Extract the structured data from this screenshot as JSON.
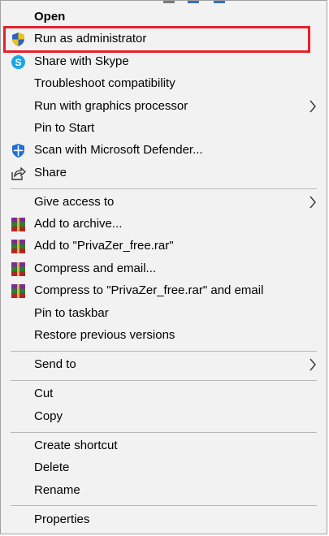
{
  "menu": {
    "items": [
      {
        "label": "Open"
      },
      {
        "label": "Run as administrator",
        "icon": "uac-shield-icon"
      },
      {
        "label": "Share with Skype",
        "icon": "skype-icon"
      },
      {
        "label": "Troubleshoot compatibility"
      },
      {
        "label": "Run with graphics processor",
        "submenu": true
      },
      {
        "label": "Pin to Start"
      },
      {
        "label": "Scan with Microsoft Defender...",
        "icon": "defender-shield-icon"
      },
      {
        "label": "Share",
        "icon": "share-icon"
      },
      {
        "label": "Give access to",
        "submenu": true
      },
      {
        "label": "Add to archive...",
        "icon": "winrar-icon"
      },
      {
        "label": "Add to \"PrivaZer_free.rar\"",
        "icon": "winrar-icon"
      },
      {
        "label": "Compress and email...",
        "icon": "winrar-icon"
      },
      {
        "label": "Compress to \"PrivaZer_free.rar\" and email",
        "icon": "winrar-icon"
      },
      {
        "label": "Pin to taskbar"
      },
      {
        "label": "Restore previous versions"
      },
      {
        "label": "Send to",
        "submenu": true
      },
      {
        "label": "Cut"
      },
      {
        "label": "Copy"
      },
      {
        "label": "Create shortcut"
      },
      {
        "label": "Delete"
      },
      {
        "label": "Rename"
      },
      {
        "label": "Properties"
      }
    ]
  },
  "colors": {
    "menu_background": "#f2f2f2",
    "highlight_border": "#e8202a",
    "separator": "#b8b8b8"
  }
}
